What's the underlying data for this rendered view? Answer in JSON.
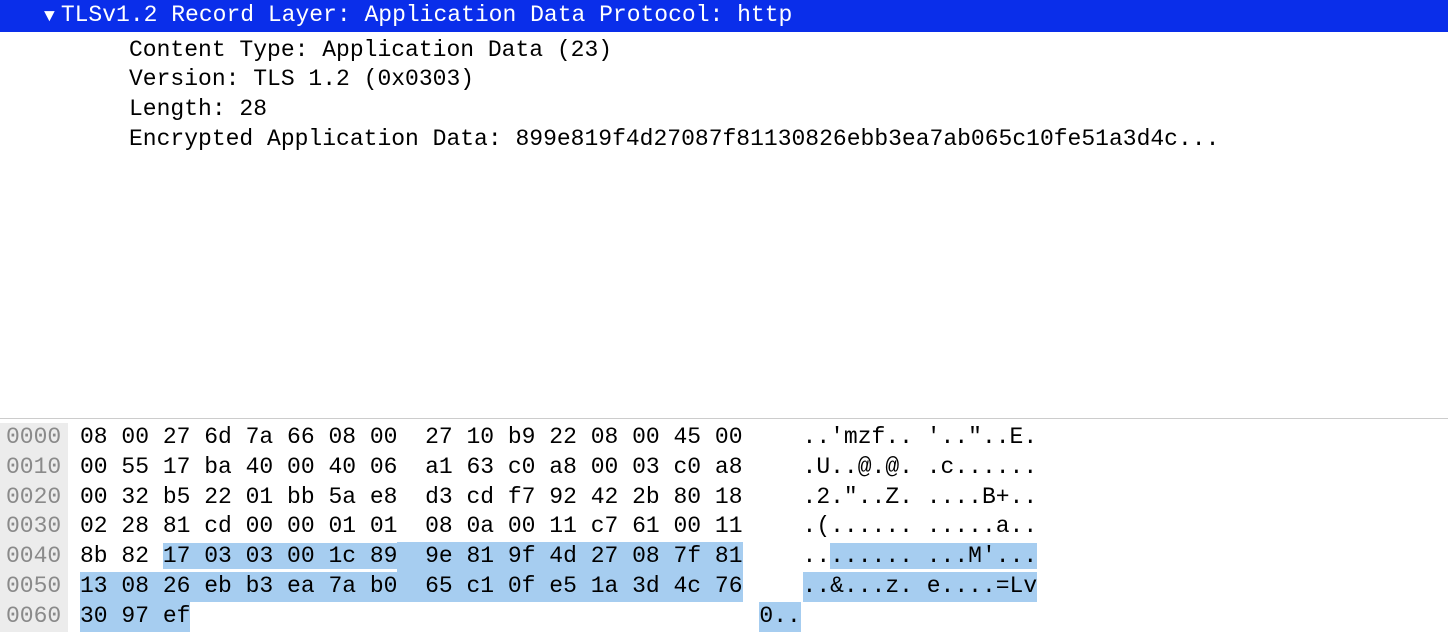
{
  "detail": {
    "header": "TLSv1.2 Record Layer: Application Data Protocol: http",
    "contentType": "Content Type: Application Data (23)",
    "version": "Version: TLS 1.2 (0x0303)",
    "length": "Length: 28",
    "encryptedData": "Encrypted Application Data: 899e819f4d27087f81130826ebb3ea7ab065c10fe51a3d4c..."
  },
  "hex": {
    "highlightOn": true,
    "rows": [
      {
        "offset": "0000",
        "b1": "08 00 27 6d 7a 66 08 00",
        "b2": "27 10 b9 22 08 00 45 00",
        "ascii": "..'mzf.. '..\"..E.",
        "hl": null
      },
      {
        "offset": "0010",
        "b1": "00 55 17 ba 40 00 40 06",
        "b2": "a1 63 c0 a8 00 03 c0 a8",
        "ascii": ".U..@.@. .c......",
        "hl": null
      },
      {
        "offset": "0020",
        "b1": "00 32 b5 22 01 bb 5a e8",
        "b2": "d3 cd f7 92 42 2b 80 18",
        "ascii": ".2.\"..Z. ....B+..",
        "hl": null
      },
      {
        "offset": "0030",
        "b1": "02 28 81 cd 00 00 01 01",
        "b2": "08 0a 00 11 c7 61 00 11",
        "ascii": ".(...... .....a..",
        "hl": null
      },
      {
        "offset": "0040",
        "b1_pre": "8b 82 ",
        "b1_hl": "17 03 03 00 1c 89",
        "b2_hl": "9e 81 9f 4d 27 08 7f 81",
        "ascii_pre": "..",
        "ascii_hl": "...... ...M'...",
        "hl": "partial"
      },
      {
        "offset": "0050",
        "b1_hl": "13 08 26 eb b3 ea 7a b0",
        "b2_hl": "65 c1 0f e5 1a 3d 4c 76",
        "ascii_hl": "..&...z. e....=Lv",
        "hl": "full"
      },
      {
        "offset": "0060",
        "b1_hl": "30 97 ef",
        "b2_hl": "",
        "ascii_hl": "0..",
        "hl": "short"
      }
    ]
  }
}
